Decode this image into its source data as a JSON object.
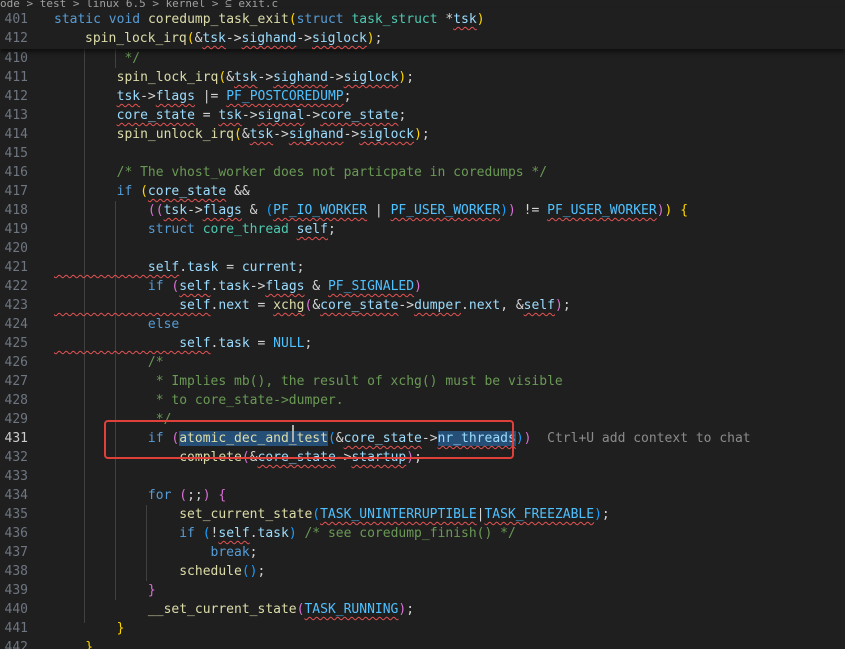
{
  "breadcrumb": "ode > test > linux 6.5 > kernel > ⊆ exit.c",
  "sticky_lines": [
    {
      "n": "401",
      "tokens": [
        [
          "kw",
          "static "
        ],
        [
          "kw",
          "void "
        ],
        [
          "fn",
          "coredump_task_exit"
        ],
        [
          "br1",
          "("
        ],
        [
          "kw",
          "struct "
        ],
        [
          "ty",
          "task_struct "
        ],
        [
          "op",
          "*"
        ],
        [
          "var",
          "tsk"
        ],
        [
          "br1",
          ")"
        ]
      ]
    },
    {
      "n": "412",
      "tokens": [
        [
          "fn",
          "spin_lock_irq"
        ],
        [
          "br1",
          "("
        ],
        [
          "op",
          "&"
        ],
        [
          "var",
          "tsk"
        ],
        [
          "op",
          "->"
        ],
        [
          "var",
          "sighand"
        ],
        [
          "op",
          "->"
        ],
        [
          "var",
          "siglock"
        ],
        [
          "br1",
          ")"
        ],
        [
          "op",
          ";"
        ]
      ]
    }
  ],
  "lines": [
    {
      "n": "410",
      "tokens": [
        [
          "cm",
          "         */"
        ]
      ]
    },
    {
      "n": "411",
      "tokens": [
        [
          "fn",
          "        spin_lock_irq"
        ],
        [
          "br1",
          "("
        ],
        [
          "op",
          "&"
        ],
        [
          "var",
          "tsk"
        ],
        [
          "op",
          "->"
        ],
        [
          "var",
          "sighand"
        ],
        [
          "op",
          "->"
        ],
        [
          "var",
          "siglock"
        ],
        [
          "br1",
          ")"
        ],
        [
          "op",
          ";"
        ]
      ]
    },
    {
      "n": "412",
      "tokens": [
        [
          "op",
          "        "
        ],
        [
          "var",
          "tsk"
        ],
        [
          "op",
          "->"
        ],
        [
          "var",
          "flags"
        ],
        [
          "op",
          " |= "
        ],
        [
          "mac",
          "PF_POSTCOREDUMP"
        ],
        [
          "op",
          ";"
        ]
      ]
    },
    {
      "n": "413",
      "tokens": [
        [
          "op",
          "        "
        ],
        [
          "var",
          "core_state"
        ],
        [
          "op",
          " = "
        ],
        [
          "var",
          "tsk"
        ],
        [
          "op",
          "->"
        ],
        [
          "var",
          "signal"
        ],
        [
          "op",
          "->"
        ],
        [
          "var",
          "core_state"
        ],
        [
          "op",
          ";"
        ]
      ]
    },
    {
      "n": "414",
      "tokens": [
        [
          "fn",
          "        spin_unlock_irq"
        ],
        [
          "br1",
          "("
        ],
        [
          "op",
          "&"
        ],
        [
          "var",
          "tsk"
        ],
        [
          "op",
          "->"
        ],
        [
          "var",
          "sighand"
        ],
        [
          "op",
          "->"
        ],
        [
          "var",
          "siglock"
        ],
        [
          "br1",
          ")"
        ],
        [
          "op",
          ";"
        ]
      ]
    },
    {
      "n": "415",
      "tokens": []
    },
    {
      "n": "416",
      "tokens": [
        [
          "cm",
          "        /* The vhost_worker does not particpate in coredumps */"
        ]
      ]
    },
    {
      "n": "417",
      "tokens": [
        [
          "kw",
          "        if "
        ],
        [
          "br1",
          "("
        ],
        [
          "var",
          "core_state"
        ],
        [
          "op",
          " &&"
        ]
      ]
    },
    {
      "n": "418",
      "tokens": [
        [
          "op",
          "            "
        ],
        [
          "br2",
          "(("
        ],
        [
          "var",
          "tsk"
        ],
        [
          "op",
          "->"
        ],
        [
          "var",
          "flags"
        ],
        [
          "op",
          " & "
        ],
        [
          "br3",
          "("
        ],
        [
          "mac",
          "PF_IO_WORKER"
        ],
        [
          "op",
          " | "
        ],
        [
          "mac",
          "PF_USER_WORKER"
        ],
        [
          "br3",
          ")"
        ],
        [
          "br2",
          ")"
        ],
        [
          "op",
          " != "
        ],
        [
          "mac",
          "PF_USER_WORKER"
        ],
        [
          "br2",
          ")"
        ],
        [
          "br1",
          ")"
        ],
        [
          "op",
          " "
        ],
        [
          "br1",
          "{"
        ]
      ]
    },
    {
      "n": "419",
      "tokens": [
        [
          "kw",
          "            struct "
        ],
        [
          "ty",
          "core_thread "
        ],
        [
          "var",
          "self"
        ],
        [
          "op",
          ";"
        ]
      ]
    },
    {
      "n": "420",
      "tokens": []
    },
    {
      "n": "421",
      "tokens": [
        [
          "var",
          "            self"
        ],
        [
          "op",
          "."
        ],
        [
          "var",
          "task"
        ],
        [
          "op",
          " = "
        ],
        [
          "var",
          "current"
        ],
        [
          "op",
          ";"
        ]
      ]
    },
    {
      "n": "422",
      "tokens": [
        [
          "kw",
          "            if "
        ],
        [
          "br2",
          "("
        ],
        [
          "var",
          "self"
        ],
        [
          "op",
          "."
        ],
        [
          "var",
          "task"
        ],
        [
          "op",
          "->"
        ],
        [
          "var",
          "flags"
        ],
        [
          "op",
          " & "
        ],
        [
          "mac",
          "PF_SIGNALED"
        ],
        [
          "br2",
          ")"
        ]
      ]
    },
    {
      "n": "423",
      "tokens": [
        [
          "var",
          "                self"
        ],
        [
          "op",
          "."
        ],
        [
          "var",
          "next"
        ],
        [
          "op",
          " = "
        ],
        [
          "fn",
          "xchg"
        ],
        [
          "br2",
          "("
        ],
        [
          "op",
          "&"
        ],
        [
          "var",
          "core_state"
        ],
        [
          "op",
          "->"
        ],
        [
          "var",
          "dumper"
        ],
        [
          "op",
          "."
        ],
        [
          "var",
          "next"
        ],
        [
          "op",
          ", &"
        ],
        [
          "var",
          "self"
        ],
        [
          "br2",
          ")"
        ],
        [
          "op",
          ";"
        ]
      ]
    },
    {
      "n": "424",
      "tokens": [
        [
          "kw",
          "            else"
        ]
      ]
    },
    {
      "n": "425",
      "tokens": [
        [
          "var",
          "                self"
        ],
        [
          "op",
          "."
        ],
        [
          "var",
          "task"
        ],
        [
          "op",
          " = "
        ],
        [
          "mac",
          "NULL"
        ],
        [
          "op",
          ";"
        ]
      ]
    },
    {
      "n": "426",
      "tokens": [
        [
          "cm",
          "            /*"
        ]
      ]
    },
    {
      "n": "427",
      "tokens": [
        [
          "cm",
          "             * Implies mb(), the result of xchg() must be visible"
        ]
      ]
    },
    {
      "n": "428",
      "tokens": [
        [
          "cm",
          "             * to core_state->dumper."
        ]
      ]
    },
    {
      "n": "429",
      "tokens": [
        [
          "cm",
          "             */"
        ]
      ]
    },
    {
      "n": "431",
      "tokens": [
        [
          "kw",
          "            if "
        ],
        [
          "br2",
          "("
        ],
        [
          "fn",
          "atomic_dec_and_test"
        ],
        [
          "br3",
          "("
        ],
        [
          "op",
          "&"
        ],
        [
          "var",
          "core_state"
        ],
        [
          "op",
          "->"
        ],
        [
          "var",
          "nr_threads"
        ],
        [
          "br3",
          ")"
        ],
        [
          "br2",
          ")"
        ],
        [
          "hint",
          "  Ctrl+U add context to chat"
        ]
      ],
      "active": true
    },
    {
      "n": "432",
      "tokens": [
        [
          "fn",
          "                complete"
        ],
        [
          "br2",
          "("
        ],
        [
          "op",
          "&"
        ],
        [
          "var",
          "core_state"
        ],
        [
          "op",
          "->"
        ],
        [
          "var",
          "startup"
        ],
        [
          "br2",
          ")"
        ],
        [
          "op",
          ";"
        ]
      ]
    },
    {
      "n": "433",
      "tokens": []
    },
    {
      "n": "434",
      "tokens": [
        [
          "kw",
          "            for "
        ],
        [
          "br2",
          "("
        ],
        [
          "op",
          ";;"
        ],
        [
          "br2",
          ")"
        ],
        [
          "op",
          " "
        ],
        [
          "br2",
          "{"
        ]
      ]
    },
    {
      "n": "435",
      "tokens": [
        [
          "fn",
          "                set_current_state"
        ],
        [
          "br3",
          "("
        ],
        [
          "mac",
          "TASK_UNINTERRUPTIBLE"
        ],
        [
          "op",
          "|"
        ],
        [
          "mac",
          "TASK_FREEZABLE"
        ],
        [
          "br3",
          ")"
        ],
        [
          "op",
          ";"
        ]
      ]
    },
    {
      "n": "436",
      "tokens": [
        [
          "kw",
          "                if "
        ],
        [
          "br3",
          "("
        ],
        [
          "op",
          "!"
        ],
        [
          "var",
          "self"
        ],
        [
          "op",
          "."
        ],
        [
          "var",
          "task"
        ],
        [
          "br3",
          ")"
        ],
        [
          "cm",
          " /* see coredump_finish() */"
        ]
      ]
    },
    {
      "n": "437",
      "tokens": [
        [
          "kw",
          "                    break"
        ],
        [
          "op",
          ";"
        ]
      ]
    },
    {
      "n": "438",
      "tokens": [
        [
          "fn",
          "                schedule"
        ],
        [
          "br3",
          "()"
        ],
        [
          "op",
          ";"
        ]
      ]
    },
    {
      "n": "439",
      "tokens": [
        [
          "br2",
          "            }"
        ]
      ]
    },
    {
      "n": "440",
      "tokens": [
        [
          "fn",
          "            __set_current_state"
        ],
        [
          "br2",
          "("
        ],
        [
          "mac",
          "TASK_RUNNING"
        ],
        [
          "br2",
          ")"
        ],
        [
          "op",
          ";"
        ]
      ]
    },
    {
      "n": "441",
      "tokens": [
        [
          "br1",
          "        }"
        ]
      ]
    },
    {
      "n": "442",
      "tokens": [
        [
          "br1",
          "    }"
        ]
      ]
    }
  ]
}
